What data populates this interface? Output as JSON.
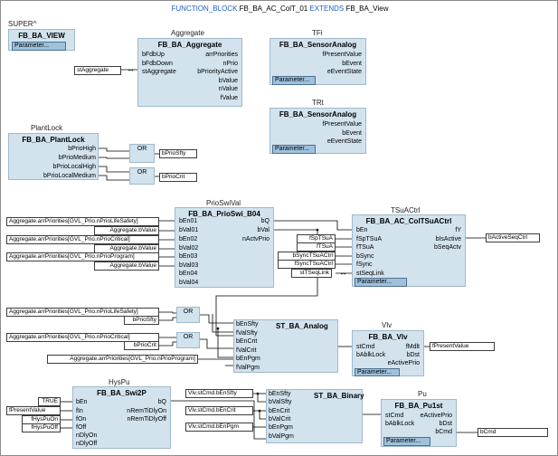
{
  "header": {
    "keyword1": "FUNCTION_BLOCK",
    "name": "FB_BA_AC_ColT_01",
    "keyword2": "EXTENDS",
    "base": "FB_BA_View"
  },
  "param_label": "Parameter...",
  "super": {
    "instance": "SUPER^",
    "type": "FB_BA_VIEW"
  },
  "aggregate": {
    "instance": "Aggregate",
    "type": "FB_BA_Aggregate",
    "inputs": [
      "bFdbUp",
      "bFdbDown",
      "stAggregate"
    ],
    "outputs": [
      "arrPriorities",
      "nPrio",
      "bPriorityActive",
      "bValue",
      "nValue",
      "fValue"
    ],
    "link": "stAggregate"
  },
  "tfi": {
    "instance": "TFi",
    "type": "FB_BA_SensorAnalog",
    "outputs": [
      "fPresentValue",
      "bEvent",
      "eEventState"
    ]
  },
  "trt": {
    "instance": "TRt",
    "type": "FB_BA_SensorAnalog",
    "outputs": [
      "fPresentValue",
      "bEvent",
      "eEventState"
    ]
  },
  "plantlock": {
    "instance": "PlantLock",
    "type": "FB_BA_PlantLock",
    "outputs": [
      "bPrioHigh",
      "bPrioMedium",
      "bPrioLocalHigh",
      "bPrioLocalMedium"
    ],
    "or_label": "OR",
    "out1": "bPrioSfty",
    "out2": "bPrioCrit"
  },
  "prioswival": {
    "instance": "PrioSwiVal",
    "type": "FB_BA_PrioSwi_B04",
    "inputs": [
      "bEn01",
      "bVal01",
      "bEn02",
      "bVal02",
      "bEn03",
      "bVal03",
      "bEn04",
      "bVal04"
    ],
    "outputs": [
      "bQ",
      "bVal",
      "nActvPrio"
    ],
    "in_vars": [
      "Aggregate.arrPriorities[GVL_Prio.nPrioLifeSafety]",
      "Aggregate.bValue",
      "Aggregate.arrPriorities[GVL_Prio.nPrioCritical]",
      "Aggregate.bValue",
      "Aggregate.arrPriorities[GVL_Prio.nPrioProgram]",
      "Aggregate.bValue"
    ]
  },
  "tsuactrl": {
    "instance": "TSuACtrl",
    "type": "FB_BA_AC_ColTSuACtrl",
    "inputs": [
      "bEn",
      "fSpTSuA",
      "fTSuA",
      "bSync",
      "fSync",
      "stSeqLink"
    ],
    "outputs": [
      "fY",
      "bIsActive",
      "bSeqActv"
    ],
    "in_vars": [
      "fSpTSuA",
      "fTSuA",
      "bSyncTSuACtrl",
      "fSyncTSuACtrl",
      "stTSeqLink"
    ],
    "out_var": "bActiveSeqCtrl"
  },
  "analog": {
    "type": "ST_BA_Analog",
    "inputs": [
      "bEnSfty",
      "fValSfty",
      "bEnCrit",
      "fValCrit",
      "bEnPgm",
      "fValPgm"
    ],
    "in_vars": [
      "Aggregate.arrPriorities[GVL_Prio.nPrioLifeSafety]",
      "bPrioSfty",
      "Aggregate.arrPriorities[GVL_Prio.nPrioCritical]",
      "bPrioCrit",
      "Aggregate.arrPriorities[GVL_Prio.nPrioProgram]"
    ],
    "or_label": "OR"
  },
  "vlv": {
    "instance": "Vlv",
    "type": "FB_BA_Vlv",
    "inputs": [
      "stCmd",
      "bAblkLock"
    ],
    "outputs": [
      "fMdlt",
      "bDst",
      "eActivePrio"
    ],
    "out_var": "fPresentValue"
  },
  "hyspu": {
    "instance": "HysPu",
    "type": "FB_BA_Swi2P",
    "inputs": [
      "bEn",
      "fIn",
      "fOn",
      "fOff",
      "nDlyOn",
      "nDlyOff"
    ],
    "outputs": [
      "bQ",
      "nRemTiDlyOn",
      "nRemTiDlyOff"
    ],
    "in_vars": [
      "TRUE",
      "fPresentValue",
      "fHysPuOn",
      "fHysPuOff"
    ]
  },
  "binary": {
    "type": "ST_BA_Binary",
    "inputs": [
      "bEnSfty",
      "bValSfty",
      "bEnCrit",
      "bValCrit",
      "bEnPgm",
      "bValPgm"
    ],
    "in_vars": [
      "Vlv.stCmd.bEnSfty",
      "Vlv.stCmd.bEnCrit",
      "Vlv.stCmd.bEnPgm"
    ]
  },
  "pu": {
    "instance": "Pu",
    "type": "FB_BA_Pu1st",
    "inputs": [
      "stCmd",
      "bAblkLock"
    ],
    "outputs": [
      "eActivePrio",
      "bDst",
      "bCmd"
    ],
    "out_var": "bCmd"
  }
}
